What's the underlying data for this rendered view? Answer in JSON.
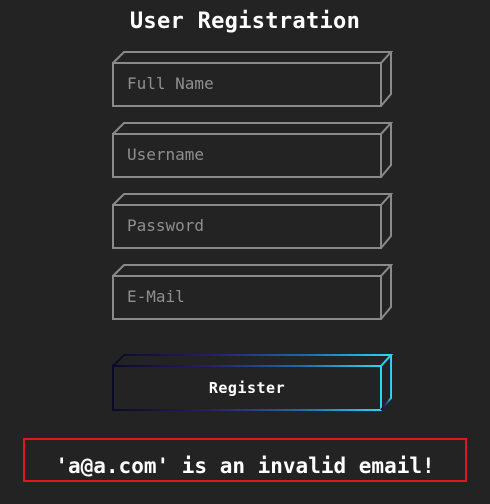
{
  "form": {
    "title": "User Registration",
    "fields": [
      {
        "name": "full-name",
        "placeholder": "Full Name",
        "value": ""
      },
      {
        "name": "username",
        "placeholder": "Username",
        "value": ""
      },
      {
        "name": "password",
        "placeholder": "Password",
        "value": ""
      },
      {
        "name": "email",
        "placeholder": "E-Mail",
        "value": ""
      }
    ],
    "register_label": "Register"
  },
  "error": {
    "message": "'a@a.com' is an invalid email!"
  },
  "colors": {
    "background": "#232323",
    "field_border": "#8a8a8a",
    "button_gradient_start": "#0a0a2a",
    "button_gradient_end": "#2ad7f5",
    "error_border": "#e0161c"
  }
}
